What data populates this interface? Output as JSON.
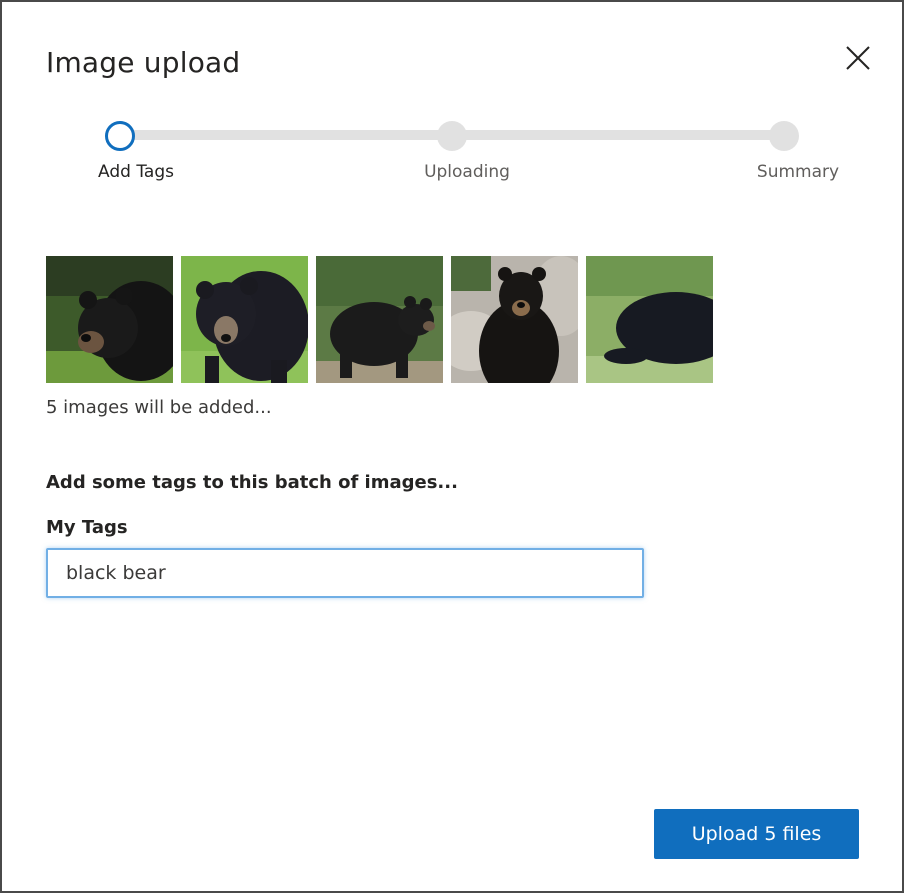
{
  "dialog": {
    "title": "Image upload",
    "close_icon": "close-icon"
  },
  "stepper": {
    "steps": [
      {
        "label": "Add Tags",
        "state": "active"
      },
      {
        "label": "Uploading",
        "state": "pending"
      },
      {
        "label": "Summary",
        "state": "pending"
      }
    ]
  },
  "thumbnails": {
    "count_text": "5 images will be added...",
    "items": [
      "bear-photo-1",
      "bear-photo-2",
      "bear-photo-3",
      "bear-photo-4",
      "bear-photo-5"
    ]
  },
  "tags_form": {
    "heading": "Add some tags to this batch of images...",
    "label": "My Tags",
    "value": "black bear"
  },
  "footer": {
    "upload_button_label": "Upload 5 files"
  },
  "colors": {
    "accent": "#106ebe",
    "input_focus": "#71afe5",
    "track": "#e1e1e1"
  }
}
